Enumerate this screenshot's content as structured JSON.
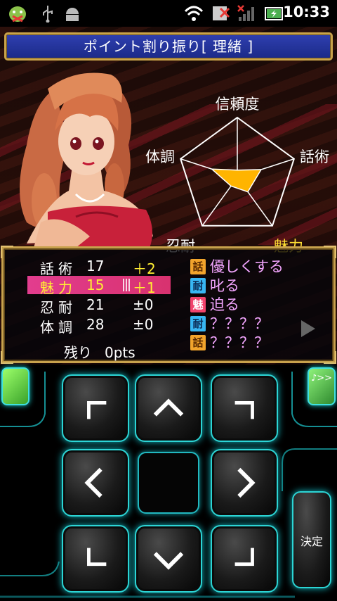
{
  "status_bar": {
    "time": "10:33",
    "icons": [
      "android-debug-icon",
      "usb-icon",
      "android-icon",
      "wifi-icon",
      "sd-card-blocked-icon",
      "signal-off-icon",
      "battery-charging-icon"
    ]
  },
  "game": {
    "title": "ポイント割り振り[ 理緒 ]",
    "radar": {
      "axes": [
        "信頼度",
        "話術",
        "魅力",
        "忍耐",
        "体調"
      ],
      "highlighted_axis": "魅力",
      "highlight_color": "#ffe033",
      "fill_color": "#ffb400",
      "values": [
        0.12,
        0.42,
        0.3,
        0.18,
        0.45
      ]
    },
    "stats": [
      {
        "name": "話術",
        "value": "17",
        "delta": "＋2",
        "selected": false
      },
      {
        "name": "魅力",
        "value": "15",
        "delta": "＋1",
        "selected": true
      },
      {
        "name": "忍耐",
        "value": "21",
        "delta": "±0",
        "selected": false
      },
      {
        "name": "体調",
        "value": "28",
        "delta": "±0",
        "selected": false
      }
    ],
    "remaining_label": "残り",
    "remaining_value": "0pts",
    "actions": [
      {
        "badge": "話",
        "badge_type": "wa",
        "label": "優しくする"
      },
      {
        "badge": "耐",
        "badge_type": "tai",
        "label": "叱る"
      },
      {
        "badge": "魅",
        "badge_type": "mi",
        "label": "迫る"
      },
      {
        "badge": "耐",
        "badge_type": "tai",
        "label": "？？？？"
      },
      {
        "badge": "話",
        "badge_type": "wa",
        "label": "？？？？"
      }
    ]
  },
  "controller": {
    "confirm_label": "決定",
    "right_side_label": "♪>>",
    "accent_color": "#2cd5d5"
  }
}
